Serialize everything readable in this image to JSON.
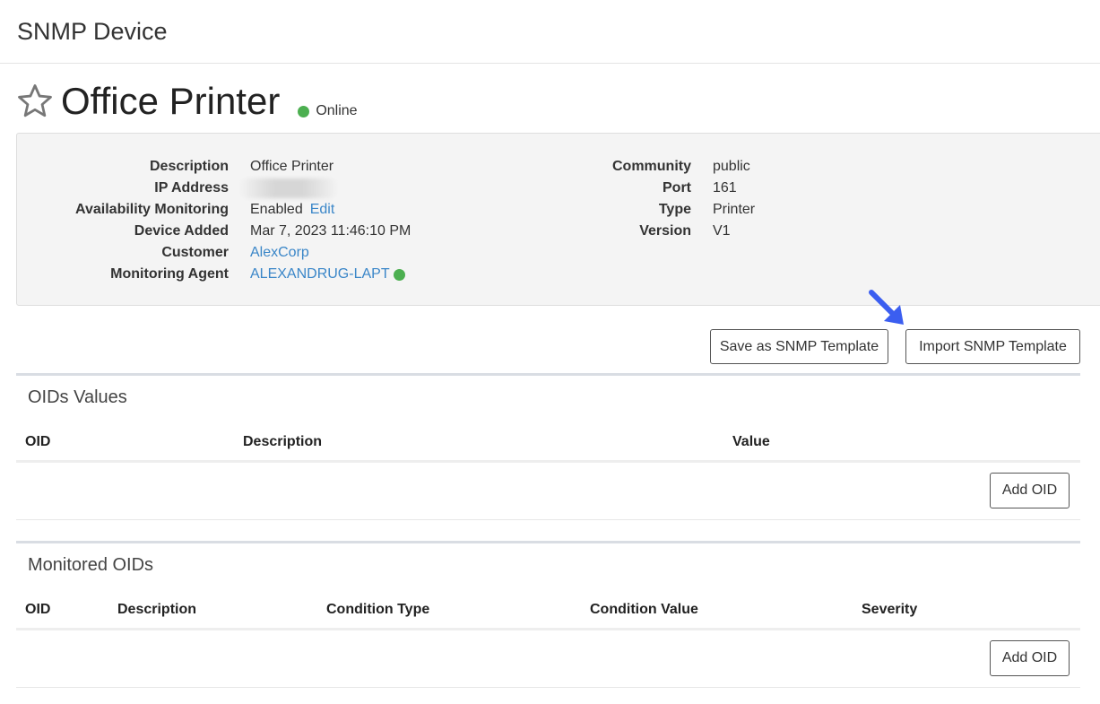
{
  "header": {
    "title": "SNMP Device"
  },
  "device": {
    "name": "Office Printer",
    "status": "Online",
    "status_color": "#4caf50"
  },
  "details_left": [
    {
      "key": "Description",
      "value": "Office Printer"
    },
    {
      "key": "IP Address",
      "value": ""
    },
    {
      "key": "Availability Monitoring",
      "value": "Enabled",
      "link": "Edit"
    },
    {
      "key": "Device Added",
      "value": "Mar 7, 2023 11:46:10 PM"
    },
    {
      "key": "Customer",
      "value": "AlexCorp"
    },
    {
      "key": "Monitoring Agent",
      "value": "ALEXANDRUG-LAPT"
    }
  ],
  "details_right": [
    {
      "key": "Community",
      "value": "public"
    },
    {
      "key": "Port",
      "value": "161"
    },
    {
      "key": "Type",
      "value": "Printer"
    },
    {
      "key": "Version",
      "value": "V1"
    }
  ],
  "actions": {
    "save_template": "Save as SNMP Template",
    "import_template": "Import SNMP Template"
  },
  "oids_values": {
    "title": "OIDs Values",
    "columns": [
      "OID",
      "Description",
      "Value"
    ],
    "add_label": "Add OID"
  },
  "monitored_oids": {
    "title": "Monitored OIDs",
    "columns": [
      "OID",
      "Description",
      "Condition Type",
      "Condition Value",
      "Severity"
    ],
    "add_label": "Add OID"
  },
  "colors": {
    "link": "#3a86c8",
    "arrow": "#3b5ef0",
    "panel_bg": "#f4f4f4"
  },
  "icons": {
    "favorite": "star-outline-icon",
    "pointer": "arrow-icon"
  }
}
